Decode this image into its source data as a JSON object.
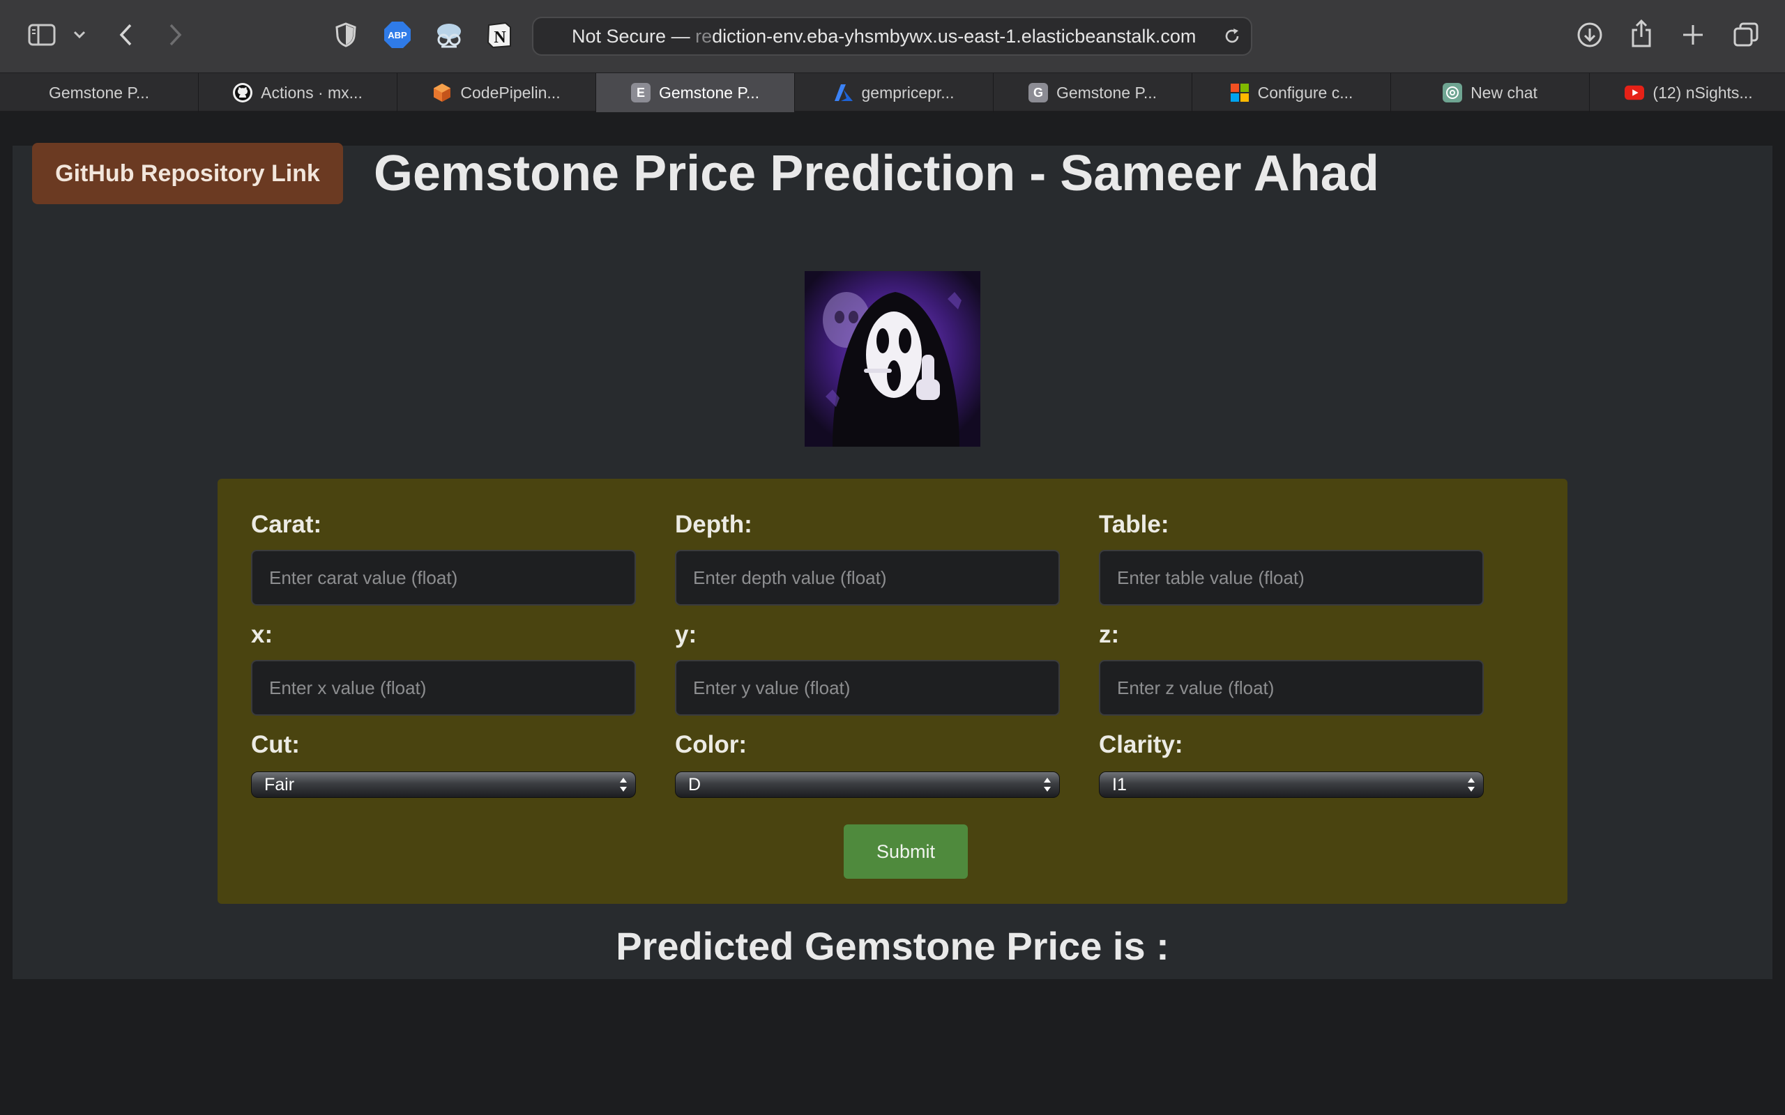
{
  "browser": {
    "address": {
      "security": "Not Secure —",
      "url_faded": " re",
      "url": "diction-env.eba-yhsmbywx.us-east-1.elasticbeanstalk.com"
    },
    "toolbar_icons": [
      "sidebar-icon",
      "chevron-down-icon",
      "back-icon",
      "forward-icon",
      "privacy-shield-icon",
      "adblock-icon",
      "extension-owl-icon",
      "notion-icon",
      "reload-icon",
      "download-icon",
      "share-icon",
      "new-tab-icon",
      "tab-overview-icon"
    ],
    "tabs": [
      {
        "label": "Gemstone P...",
        "icon": "none",
        "active": false
      },
      {
        "label": "Actions · mx...",
        "icon": "github-icon",
        "active": false
      },
      {
        "label": "CodePipelin...",
        "icon": "aws-codepipeline-icon",
        "active": false
      },
      {
        "label": "Gemstone P...",
        "icon": "letter-e-icon",
        "fav_letter": "E",
        "active": true
      },
      {
        "label": "gempricepr...",
        "icon": "azure-icon",
        "active": false
      },
      {
        "label": "Gemstone P...",
        "icon": "letter-g-icon",
        "fav_letter": "G",
        "active": false
      },
      {
        "label": "Configure c...",
        "icon": "microsoft-icon",
        "active": false
      },
      {
        "label": "New chat",
        "icon": "chatgpt-icon",
        "active": false
      },
      {
        "label": "(12) nSights...",
        "icon": "youtube-icon",
        "active": false
      }
    ]
  },
  "page": {
    "github_link": "GitHub Repository Link",
    "title": "Gemstone Price Prediction - Sameer Ahad",
    "form": {
      "fields": [
        {
          "label": "Carat:",
          "placeholder": "Enter carat value (float)"
        },
        {
          "label": "Depth:",
          "placeholder": "Enter depth value (float)"
        },
        {
          "label": "Table:",
          "placeholder": "Enter table value (float)"
        },
        {
          "label": "x:",
          "placeholder": "Enter x value (float)"
        },
        {
          "label": "y:",
          "placeholder": "Enter y value (float)"
        },
        {
          "label": "z:",
          "placeholder": "Enter z value (float)"
        }
      ],
      "selects": [
        {
          "label": "Cut:",
          "value": "Fair"
        },
        {
          "label": "Color:",
          "value": "D"
        },
        {
          "label": "Clarity:",
          "value": "I1"
        }
      ],
      "submit": "Submit"
    },
    "result": "Predicted Gemstone Price is :"
  },
  "colors": {
    "page_bg": "#282b2e",
    "form_bg": "#4a4410",
    "github_btn": "#6b3a22",
    "submit_btn": "#4f8a3d"
  }
}
